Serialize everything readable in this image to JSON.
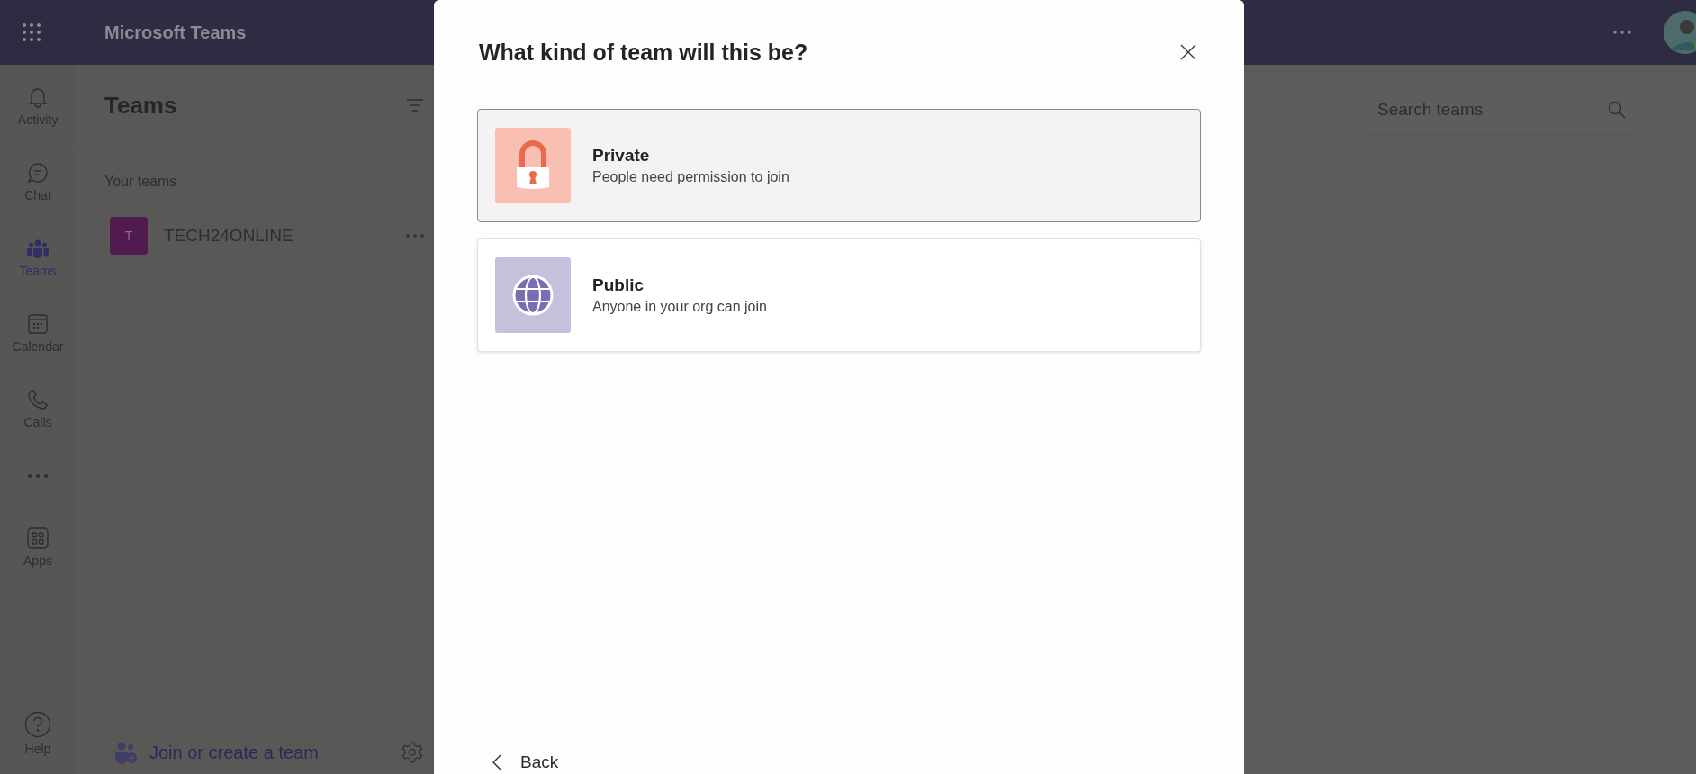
{
  "app": {
    "title": "Microsoft Teams"
  },
  "rail": [
    {
      "label": "Activity",
      "selected": false
    },
    {
      "label": "Chat",
      "selected": false
    },
    {
      "label": "Teams",
      "selected": true
    },
    {
      "label": "Calendar",
      "selected": false
    },
    {
      "label": "Calls",
      "selected": false
    },
    {
      "label": "Apps",
      "selected": false
    },
    {
      "label": "Help",
      "selected": false
    }
  ],
  "teams_panel": {
    "title": "Teams",
    "section": "Your teams",
    "teams": [
      {
        "initial": "T",
        "name": "TECH24ONLINE"
      }
    ],
    "join": "Join or create a team"
  },
  "search": {
    "placeholder": "Search teams"
  },
  "dialog": {
    "title": "What kind of team will this be?",
    "options": [
      {
        "kind": "private",
        "title": "Private",
        "description": "People need permission to join",
        "selected": true
      },
      {
        "kind": "public",
        "title": "Public",
        "description": "Anyone in your org can join",
        "selected": false
      }
    ],
    "back": "Back"
  }
}
